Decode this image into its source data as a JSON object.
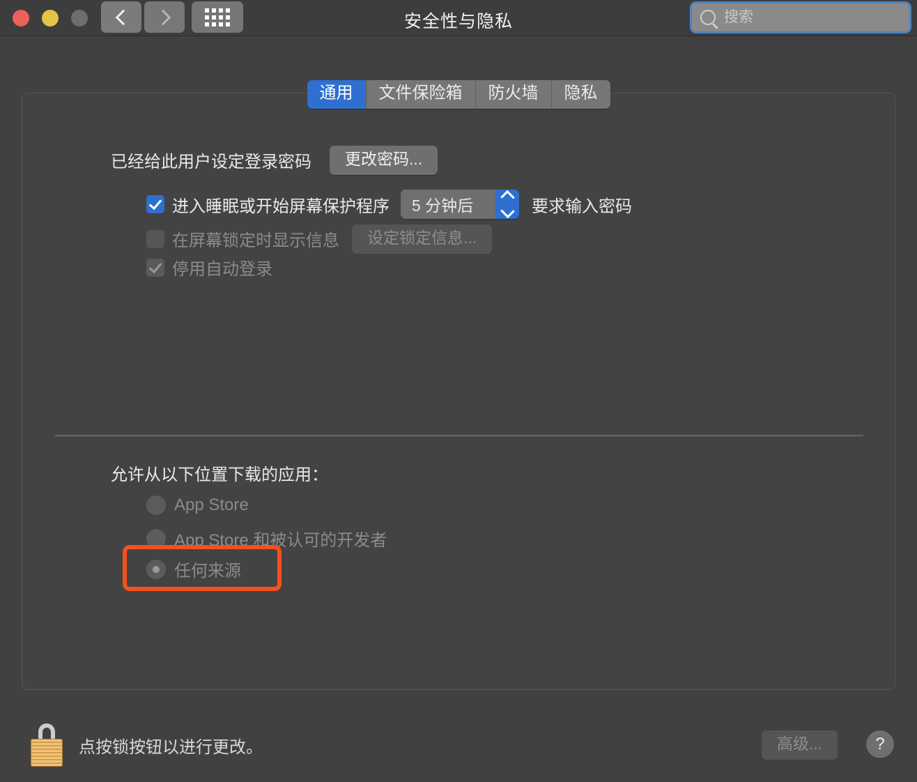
{
  "window": {
    "title": "安全性与隐私",
    "traffic_lights": {
      "close": "close-button",
      "minimize": "minimize-button",
      "zoom": "zoom-button"
    },
    "nav": {
      "back": "back-button",
      "forward": "forward-button",
      "show_all": "show-all-button"
    },
    "search": {
      "placeholder": "搜索",
      "value": ""
    },
    "colors": {
      "accent_blue": "#2f6fd0",
      "focus_ring": "#4b84c4",
      "highlight_orange": "#f4511e",
      "toolbar_bg": "#3d3d3d",
      "window_bg": "#414141",
      "panel_bg": "#434343"
    }
  },
  "tabs": [
    {
      "label": "通用",
      "active": true
    },
    {
      "label": "文件保险箱",
      "active": false
    },
    {
      "label": "防火墙",
      "active": false
    },
    {
      "label": "隐私",
      "active": false
    }
  ],
  "general": {
    "password_status": "已经给此用户设定登录密码",
    "change_password_button": "更改密码...",
    "require_password": {
      "checkbox_label": "进入睡眠或开始屏幕保护程序",
      "checked": true,
      "delay_value": "5 分钟后",
      "suffix_label": "要求输入密码"
    },
    "screen_lock_message": {
      "checkbox_label": "在屏幕锁定时显示信息",
      "checked": false,
      "enabled": false,
      "button_label": "设定锁定信息..."
    },
    "disable_auto_login": {
      "checkbox_label": "停用自动登录",
      "checked": true,
      "enabled": false
    },
    "download_sources": {
      "heading": "允许从以下位置下载的应用：",
      "options": [
        {
          "label": "App Store",
          "selected": false
        },
        {
          "label": "App Store 和被认可的开发者",
          "selected": false
        },
        {
          "label": "任何来源",
          "selected": true,
          "highlighted": true
        }
      ]
    }
  },
  "footer": {
    "lock_icon": "lock-closed-icon",
    "lock_text": "点按锁按钮以进行更改。",
    "advanced_button": "高级...",
    "help_button": "?"
  }
}
